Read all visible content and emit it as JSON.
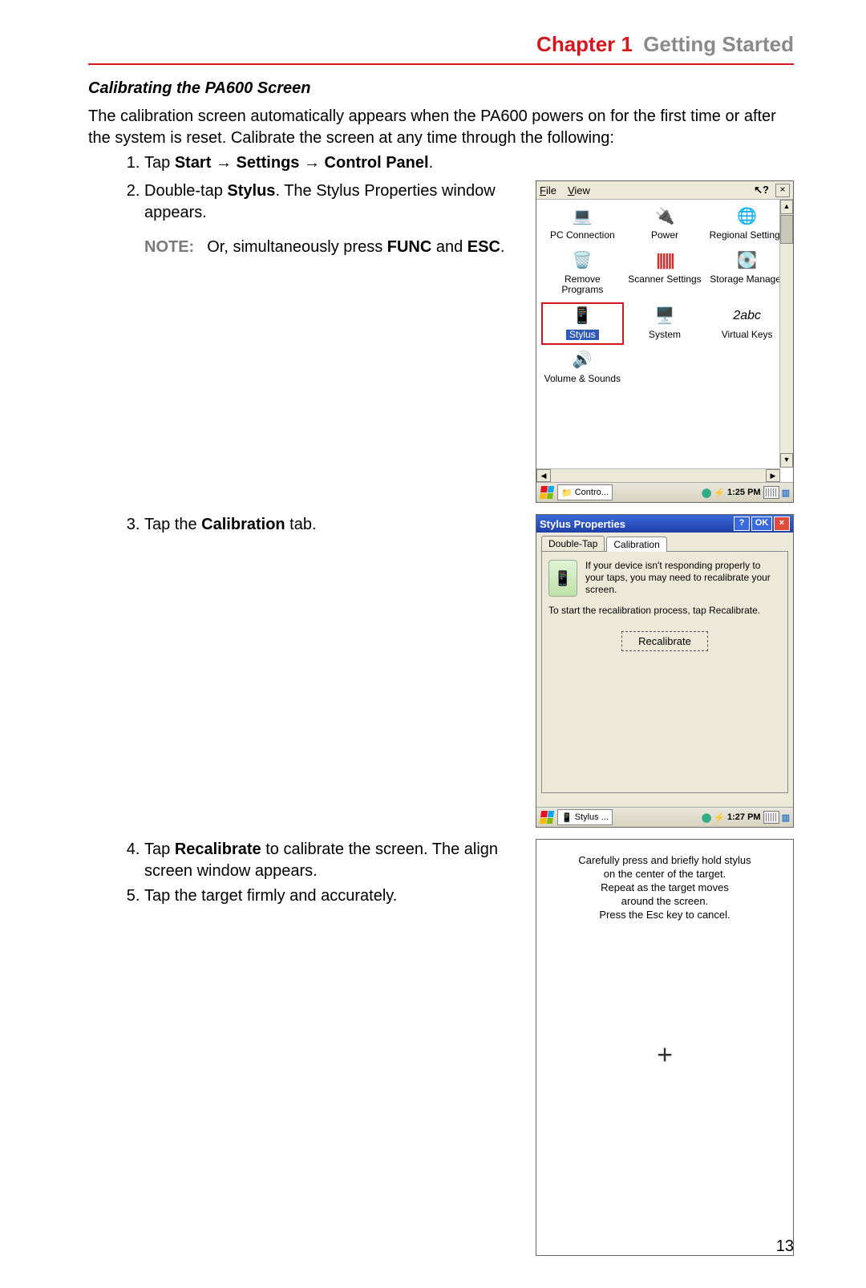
{
  "header": {
    "chapter": "Chapter 1",
    "title": "Getting Started"
  },
  "section_title": "Calibrating the PA600 Screen",
  "intro": "The calibration screen automatically appears when the PA600 powers on for the first time or after the system is reset. Calibrate the screen at any time through the following:",
  "steps": {
    "s1_pre": "Tap ",
    "s1_b1": "Start",
    "s1_arrow": " → ",
    "s1_b2": "Settings",
    "s1_b3": "Control Panel",
    "s1_post": ".",
    "s2_pre": "Double-tap ",
    "s2_b": "Stylus",
    "s2_post": ". The Stylus Properties window appears.",
    "s3_pre": "Tap the ",
    "s3_b": "Calibration",
    "s3_post": " tab.",
    "s4_pre": "Tap ",
    "s4_b": "Recalibrate",
    "s4_post": " to calibrate the screen. The align screen window appears.",
    "s5": "Tap the target firmly and accurately."
  },
  "note": {
    "label": "NOTE:",
    "pre": "Or, simultaneously press ",
    "b1": "FUNC",
    "mid": " and ",
    "b2": "ESC",
    "post": "."
  },
  "shot1": {
    "menu_file": "File",
    "menu_view": "View",
    "help_cursor": "↖?",
    "close": "×",
    "items": {
      "pc_connection": "PC Connection",
      "power": "Power",
      "regional": "Regional Settings",
      "remove": "Remove Programs",
      "scanner": "Scanner Settings",
      "storage": "Storage Manager",
      "stylus": "Stylus",
      "system": "System",
      "vk_icon": "2abc",
      "vkeys": "Virtual Keys",
      "volume": "Volume & Sounds"
    },
    "task_label": "Contro...",
    "time": "1:25 PM"
  },
  "shot2": {
    "title": "Stylus Properties",
    "ok": "OK",
    "help": "?",
    "close": "×",
    "tab1": "Double-Tap",
    "tab2": "Calibration",
    "tip": "If your device isn't responding properly to your taps, you may need to recalibrate your screen.",
    "start": "To start the recalibration process, tap Recalibrate.",
    "button": "Recalibrate",
    "task_label": "Stylus ...",
    "time": "1:27 PM"
  },
  "shot3": {
    "l1": "Carefully press and briefly hold stylus",
    "l2": "on the center of the target.",
    "l3": "Repeat as the target moves",
    "l4": "around the screen.",
    "l5": "Press the Esc key to cancel.",
    "target": "+"
  },
  "page_number": "13"
}
